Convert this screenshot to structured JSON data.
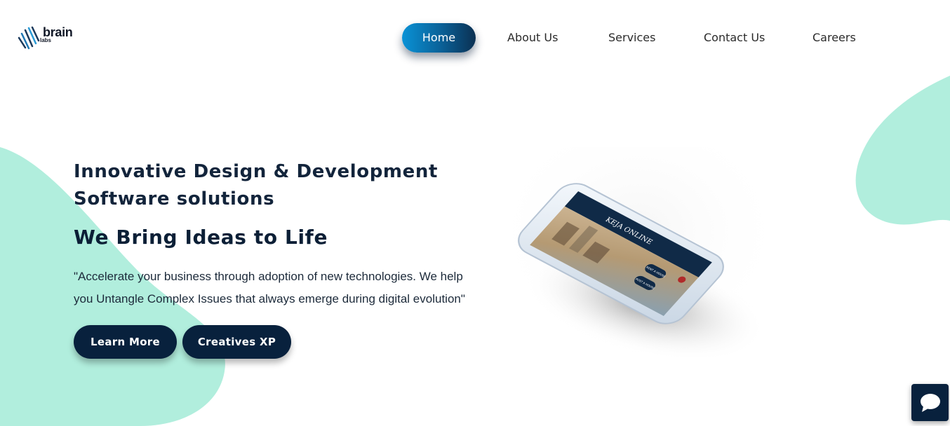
{
  "brand": {
    "name": "brain",
    "sub": "labs",
    "colors": {
      "accent": "#0a92d6",
      "navy": "#08213d",
      "mint": "#b1eedd"
    }
  },
  "nav": {
    "items": [
      {
        "label": "Home",
        "active": true
      },
      {
        "label": "About Us",
        "active": false
      },
      {
        "label": "Services",
        "active": false
      },
      {
        "label": "Contact Us",
        "active": false
      },
      {
        "label": "Careers",
        "active": false
      }
    ]
  },
  "hero": {
    "tagline": "Innovative Design & Development Software solutions",
    "headline": "We Bring Ideas to Life",
    "description": "\"Accelerate your business through adoption of new technologies. We help you Untangle Complex Issues that always emerge during digital evolution\"",
    "buttons": {
      "learn_more": "Learn More",
      "creatives": "Creatives XP"
    },
    "phone_mockup": {
      "app_title": "KEJA ONLINE",
      "action_primary": "RENT A HOUSE",
      "action_secondary": "POST A HOUSE"
    }
  },
  "chat": {
    "icon": "chat-bubble-icon"
  }
}
